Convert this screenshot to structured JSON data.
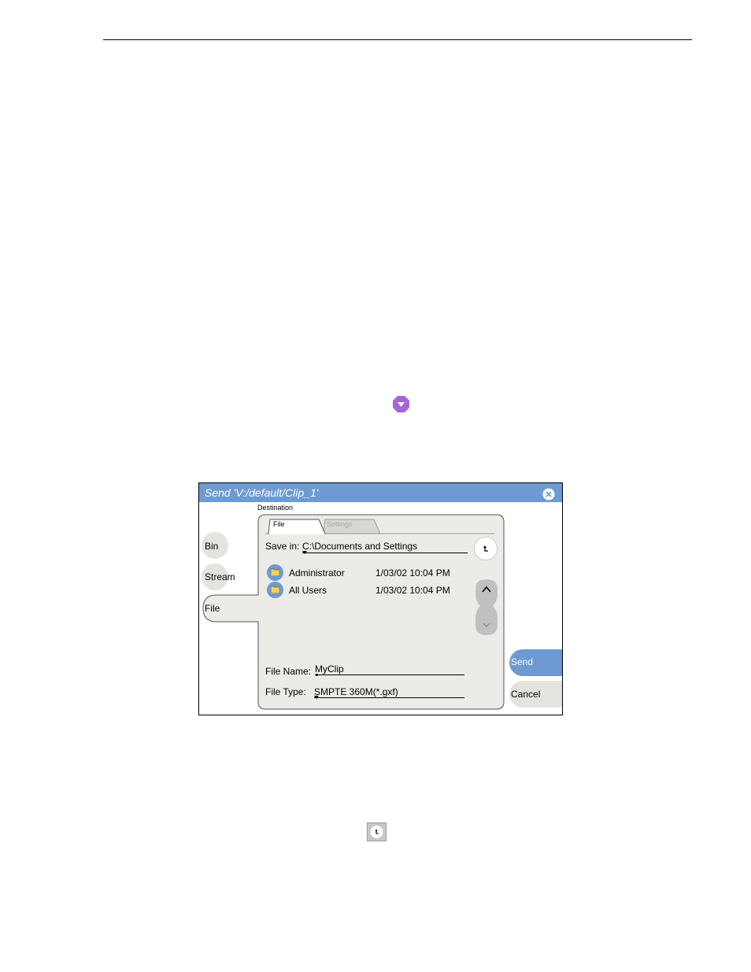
{
  "dialog": {
    "title": "Send 'V:/default/Clip_1'",
    "close_icon": "close-icon",
    "destination_label": "Destination",
    "side_tabs": [
      {
        "label": "Bin"
      },
      {
        "label": "Stream"
      },
      {
        "label": "File"
      }
    ],
    "inner_tabs": [
      {
        "label": "File"
      },
      {
        "label": "Settings"
      }
    ],
    "save_in": {
      "label": "Save in:",
      "value": "C:\\Documents and Settings"
    },
    "files": [
      {
        "name": "Administrator",
        "date": "1/03/02 10:04 PM"
      },
      {
        "name": "All Users",
        "date": "1/03/02 10:04 PM"
      }
    ],
    "file_name": {
      "label": "File Name:",
      "value": "MyClip"
    },
    "file_type": {
      "label": "File Type:",
      "value": "SMPTE 360M(*.gxf)"
    },
    "send_label": "Send",
    "cancel_label": "Cancel"
  },
  "colors": {
    "accent": "#6d9ad0",
    "purple_icon": "#a565d8",
    "panel": "#ecebe8"
  },
  "icons": [
    "dropdown-arrow-icon",
    "up-one-level-icon",
    "folder-icon",
    "scroll-up-icon",
    "scroll-down-icon"
  ]
}
